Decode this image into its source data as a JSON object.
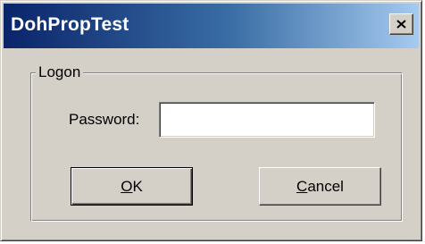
{
  "window": {
    "title": "DohPropTest"
  },
  "group": {
    "label": "Logon"
  },
  "password": {
    "label": "Password:",
    "value": ""
  },
  "buttons": {
    "ok": {
      "accel": "O",
      "rest": "K"
    },
    "cancel": {
      "accel": "C",
      "rest": "ancel"
    }
  },
  "icons": {
    "close": "close-icon"
  },
  "colors": {
    "titlebar_start": "#0a246a",
    "titlebar_end": "#a6caf0",
    "face": "#d4d0c8"
  }
}
